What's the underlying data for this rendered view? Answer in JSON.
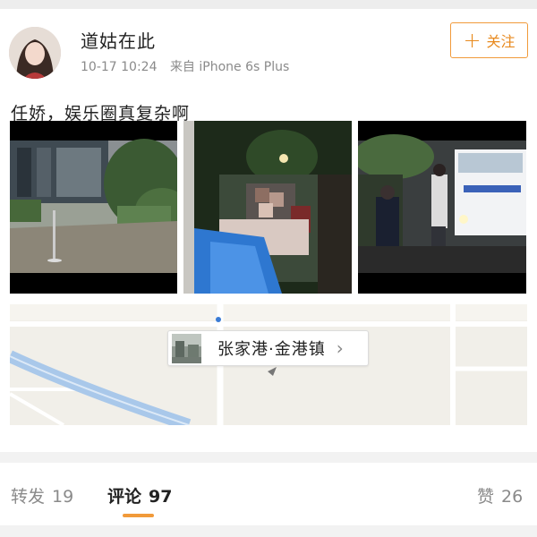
{
  "post": {
    "username": "道姑在此",
    "time": "10-17 10:24",
    "source": "来自 iPhone 6s Plus",
    "follow_label": "关注",
    "text": "任娇，娱乐圈真复杂啊"
  },
  "location": {
    "name": "张家港·金港镇"
  },
  "tabs": {
    "repost_label": "转发",
    "repost_count": "19",
    "comment_label": "评论",
    "comment_count": "97",
    "like_label": "赞",
    "like_count": "26"
  },
  "colors": {
    "accent": "#f19a3a",
    "text": "#222222",
    "muted": "#8a8a8a"
  },
  "icons": {
    "follow": "plus-icon",
    "location_arrow": "chevron-right-icon"
  }
}
